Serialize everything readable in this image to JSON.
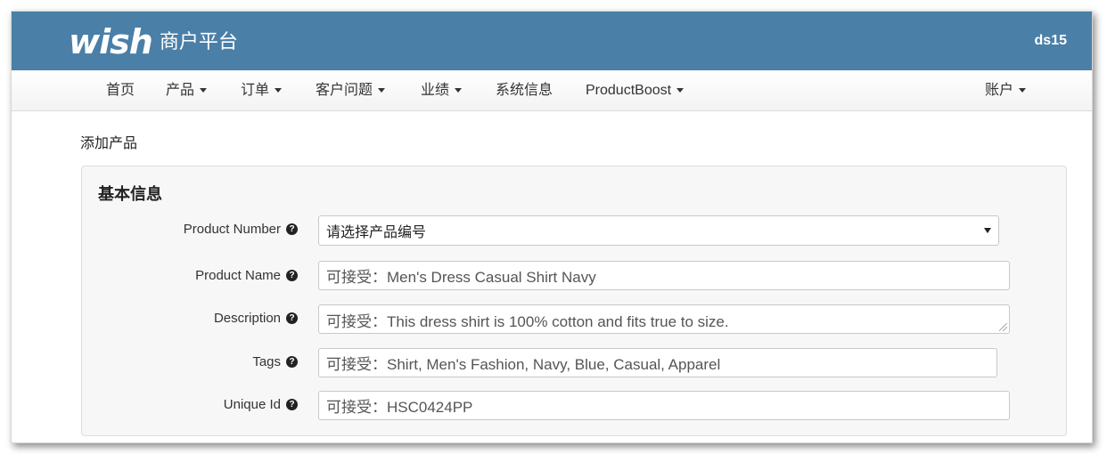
{
  "header": {
    "logo_text": "wish",
    "platform_name": "商户平台",
    "username": "ds15"
  },
  "nav": {
    "items": [
      {
        "label": "首页",
        "has_dropdown": false
      },
      {
        "label": "产品",
        "has_dropdown": true
      },
      {
        "label": "订单",
        "has_dropdown": true
      },
      {
        "label": "客户问题",
        "has_dropdown": true
      },
      {
        "label": "业绩",
        "has_dropdown": true
      },
      {
        "label": "系统信息",
        "has_dropdown": false
      },
      {
        "label": "ProductBoost",
        "has_dropdown": true
      }
    ],
    "account": {
      "label": "账户",
      "has_dropdown": true
    }
  },
  "page": {
    "title": "添加产品"
  },
  "form": {
    "section_title": "基本信息",
    "fields": [
      {
        "label": "Product Number",
        "type": "select",
        "value": "请选择产品编号"
      },
      {
        "label": "Product Name",
        "type": "text",
        "placeholder": "可接受：Men's Dress Casual Shirt Navy"
      },
      {
        "label": "Description",
        "type": "textarea",
        "placeholder": "可接受：This dress shirt is 100% cotton and fits true to size."
      },
      {
        "label": "Tags",
        "type": "text",
        "placeholder": "可接受：Shirt, Men's Fashion, Navy, Blue, Casual, Apparel"
      },
      {
        "label": "Unique Id",
        "type": "text",
        "placeholder": "可接受：HSC0424PP"
      }
    ]
  },
  "colors": {
    "header_bg": "#4a7fa8",
    "panel_bg": "#f7f7f7"
  },
  "icons": {
    "help": "question-circle-icon",
    "dropdown": "caret-down-icon"
  }
}
